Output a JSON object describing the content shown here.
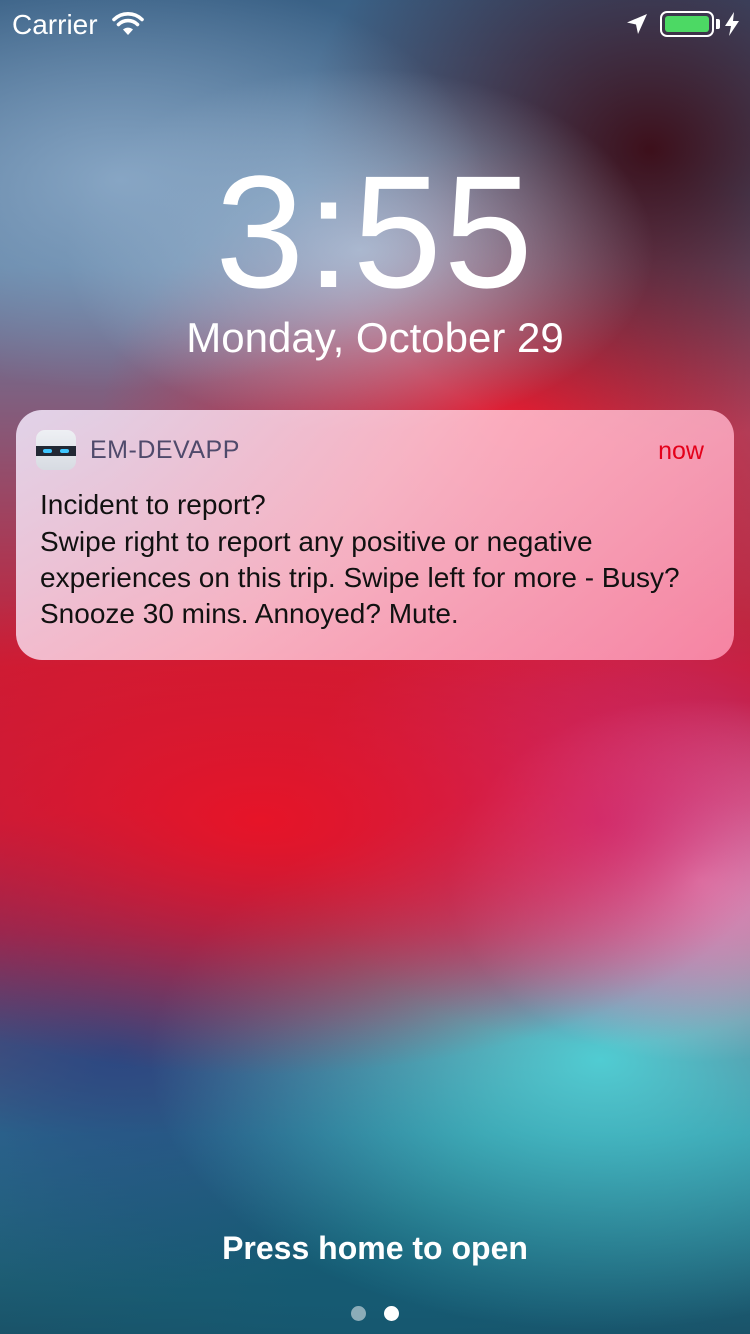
{
  "status_bar": {
    "carrier": "Carrier",
    "wifi_icon": "wifi-icon",
    "location_icon": "location-arrow-icon",
    "battery_level": 1.0,
    "battery_color": "#4cd964",
    "charging_icon": "charging-bolt-icon"
  },
  "lock_screen": {
    "time": "3:55",
    "date": "Monday, October 29"
  },
  "notification": {
    "app_name": "EM-DEVAPP",
    "app_icon": "robot-face-icon",
    "time_ago": "now",
    "time_ago_color": "#e4001a",
    "title": "Incident to report?",
    "body": "Swipe right to report any positive or negative experiences on this trip. Swipe left for more - Busy? Snooze 30 mins. Annoyed? Mute."
  },
  "footer": {
    "hint": "Press home to open",
    "pages": 2,
    "active_page": 2
  }
}
